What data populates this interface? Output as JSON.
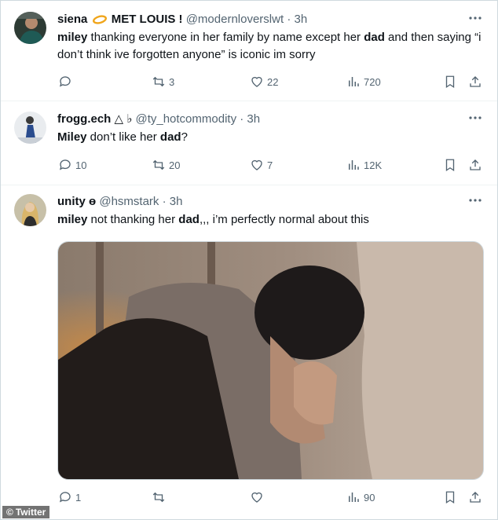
{
  "tweets": [
    {
      "name": "siena",
      "name_suffix": "MET LOUIS !",
      "handle": "@modernloverslwt",
      "dot": "·",
      "time": "3h",
      "text_parts": [
        "miley",
        " thanking everyone in her family by name except her ",
        "dad",
        " and then saying “i don’t think ive forgotten anyone” is iconic im sorry"
      ],
      "replies": "",
      "retweets": "3",
      "likes": "22",
      "views": "720"
    },
    {
      "name": "frogg.ech",
      "name_suffix": "△ ♭",
      "handle": "@ty_hotcommodity",
      "dot": "·",
      "time": "3h",
      "text_parts": [
        "Miley",
        " don’t like her ",
        "dad",
        "?"
      ],
      "replies": "10",
      "retweets": "20",
      "likes": "7",
      "views": "12K"
    },
    {
      "name": "unity",
      "name_suffix": "ɵ",
      "handle": "@hsmstark",
      "dot": "·",
      "time": "3h",
      "text_parts": [
        "miley",
        " not thanking her ",
        "dad",
        ",,, i’m perfectly normal about this"
      ],
      "replies": "1",
      "retweets": "",
      "likes": "",
      "views": "90"
    }
  ],
  "watermark": "Twitter",
  "colors": {
    "text": "#0f1419",
    "muted": "#536471",
    "border": "#eff3f4"
  }
}
